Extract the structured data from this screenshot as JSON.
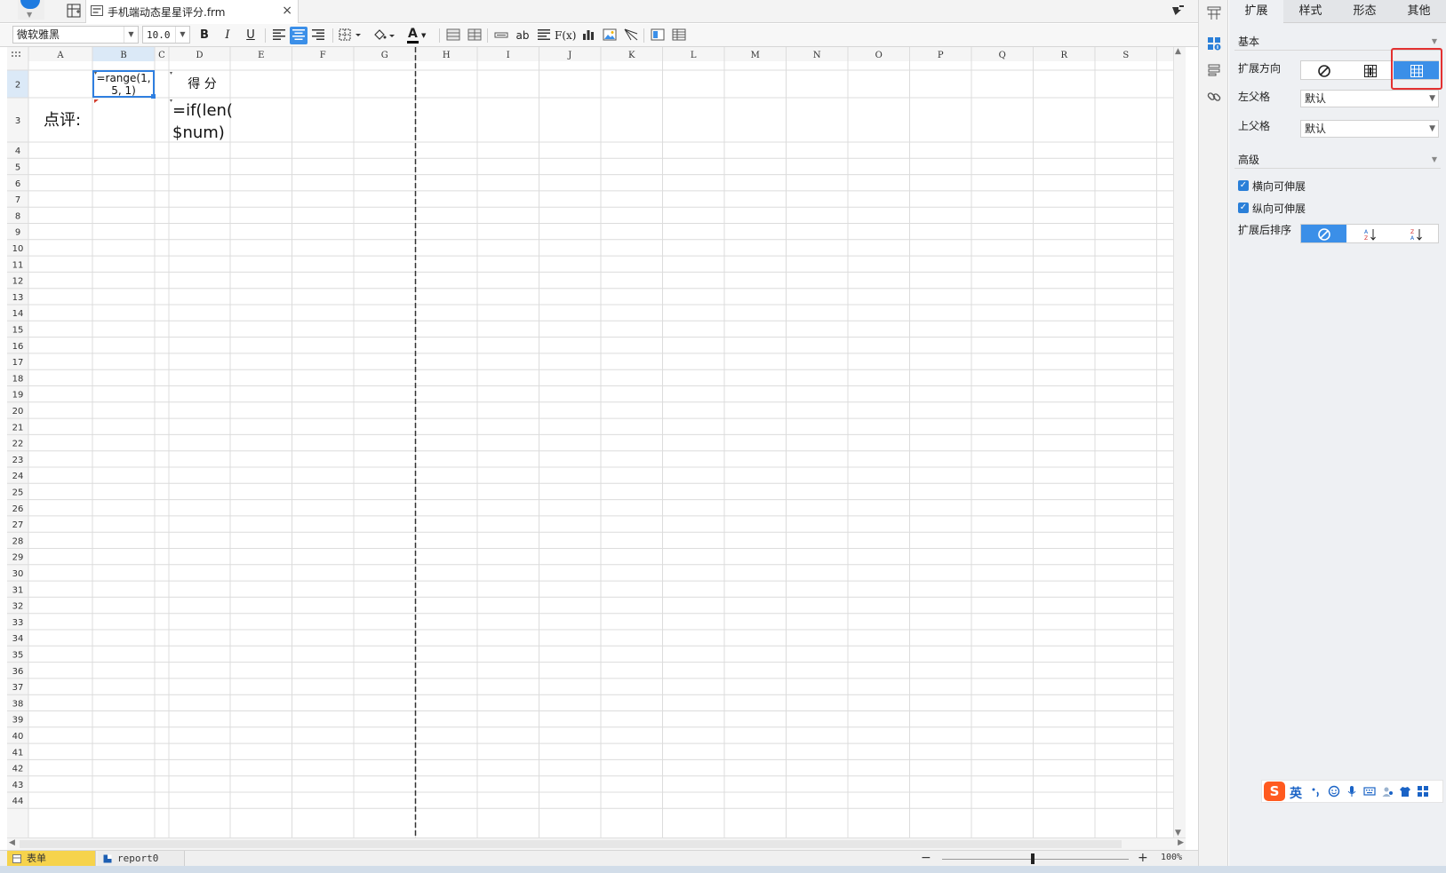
{
  "tabbar": {
    "doc_title": "手机端动态星星评分.frm",
    "close_glyph": "×"
  },
  "toolbar": {
    "font_name": "微软雅黑",
    "font_size": "10.0",
    "bold": "B",
    "italic": "I",
    "underline": "U",
    "text_ab": "ab",
    "formula": "F(x)",
    "font_color_letter": "A",
    "font_color": "#000000"
  },
  "grid": {
    "columns": [
      "A",
      "B",
      "C",
      "D",
      "E",
      "F",
      "G",
      "H",
      "I",
      "J",
      "K",
      "L",
      "M",
      "N",
      "O",
      "P",
      "Q",
      "R",
      "S"
    ],
    "rows": [
      "2",
      "3",
      "4",
      "5",
      "6",
      "7",
      "8",
      "9",
      "10",
      "11",
      "12",
      "13",
      "14",
      "15",
      "16",
      "17",
      "18",
      "19",
      "20",
      "21",
      "22",
      "23",
      "24",
      "25",
      "26",
      "27",
      "28",
      "29",
      "30",
      "31",
      "32",
      "33",
      "34",
      "35",
      "36",
      "37",
      "38",
      "39",
      "40",
      "41",
      "42",
      "43",
      "44"
    ],
    "selected_column": "B",
    "selected_row": "2",
    "cells": {
      "B2_line1": "=range(1,",
      "B2_line2": "5, 1)",
      "D2": "得 分",
      "A3": "点评:",
      "D3_line1": "=if(len(",
      "D3_line2": "$num)"
    },
    "header_bg": "#f5f5f5",
    "selected_header_bg": "#dbe9f7",
    "selection_color": "#2f7fe0",
    "grid_color": "#dcdcdc"
  },
  "sheet_tabs": {
    "form": "表单",
    "report": "report0"
  },
  "zoom": {
    "minus": "−",
    "plus": "+",
    "level": "100%"
  },
  "panel": {
    "tabs": [
      "扩展",
      "样式",
      "形态",
      "其他"
    ],
    "active_tab": "扩展",
    "basic": {
      "title": "基本",
      "expand_direction_label": "扩展方向",
      "left_parent_label": "左父格",
      "left_parent_value": "默认",
      "top_parent_label": "上父格",
      "top_parent_value": "默认"
    },
    "advanced": {
      "title": "高级",
      "horizontal_expandable": "横向可伸展",
      "vertical_expandable": "纵向可伸展",
      "sort_after_expand": "扩展后排序",
      "check_glyph": "✓"
    },
    "accent_color": "#3b8fe8",
    "highlight_color": "#e33131"
  },
  "ime": {
    "logo": "S",
    "lang": "英"
  }
}
